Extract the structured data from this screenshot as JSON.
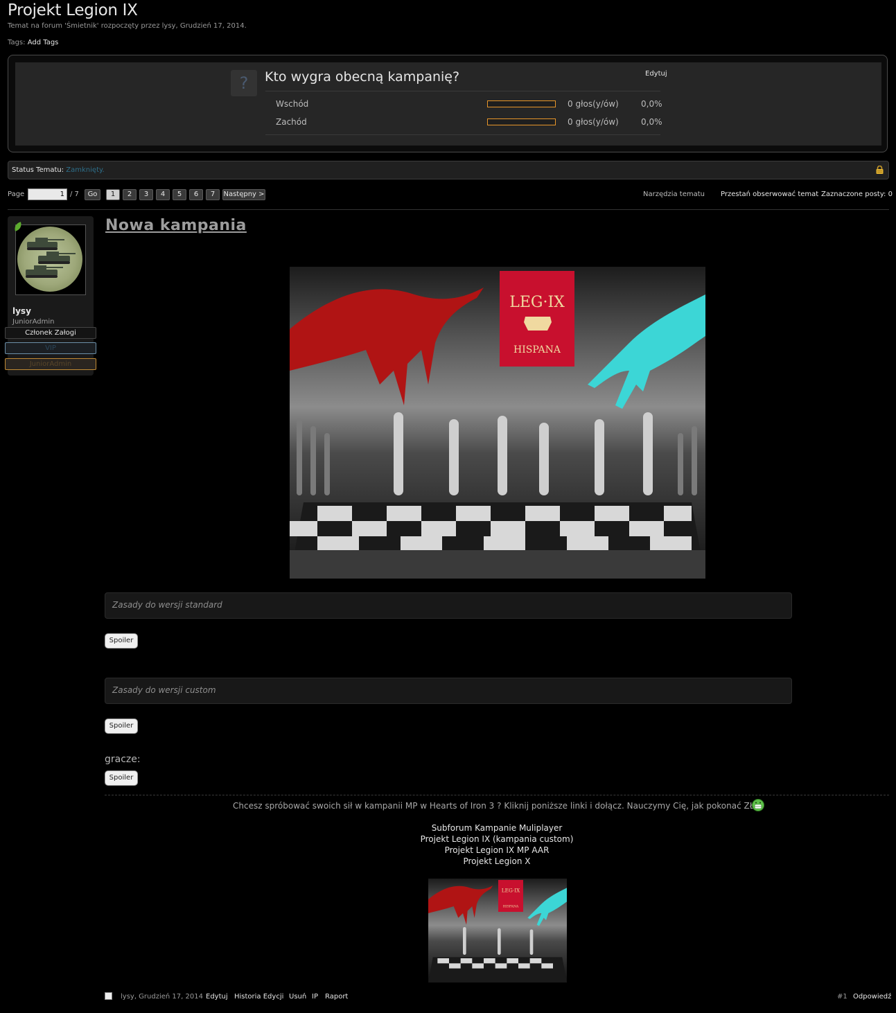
{
  "thread": {
    "title": "Projekt Legion IX",
    "subtitle": "Temat na forum 'Śmietnik' rozpoczęty przez lysy, Grudzień 17, 2014.",
    "tags_label": "Tags:",
    "add_tags": "Add Tags"
  },
  "poll": {
    "icon": "question-icon",
    "question": "Kto wygra obecną kampanię?",
    "edit_label": "Edytuj",
    "options": [
      {
        "label": "Wschód",
        "votes": "0 głos(y/ów)",
        "percent": "0,0%",
        "fill": 0
      },
      {
        "label": "Zachód",
        "votes": "0 głos(y/ów)",
        "percent": "0,0%",
        "fill": 0
      }
    ]
  },
  "status": {
    "label": "Status Tematu:",
    "value": "Zamknięty.",
    "icon": "lock-icon"
  },
  "pagination": {
    "page_label": "Page",
    "current": "1",
    "total": "/ 7",
    "go": "Go",
    "pages": [
      "1",
      "2",
      "3",
      "4",
      "5",
      "6",
      "7"
    ],
    "next": "Następny >",
    "thread_tools": "Narzędzia tematu",
    "unwatch": "Przestań obserwować temat",
    "selected_posts": "Zaznaczone posty: 0"
  },
  "user": {
    "name": "lysy",
    "title": "JuniorAdmin",
    "badges": [
      "Członek Załogi",
      "VIP",
      "JuniorAdmin"
    ]
  },
  "post": {
    "title": "Nowa kampania",
    "hero_logo_line1": "LEG·IX",
    "hero_logo_line2": "HISPANA",
    "quote1": "Zasady do wersji standard",
    "quote2": "Zasady do wersji custom",
    "spoiler": "Spoiler",
    "players": "gracze:"
  },
  "signature": {
    "text": "Chcesz spróbować swoich sił w kampanii MP w Hearts of Iron 3 ? Kliknij poniższe linki i dołącz. Nauczymy Cię, jak pokonać ZŁO",
    "links": [
      "Subforum Kampanie Muliplayer",
      "Projekt Legion IX (kampania custom)",
      "Projekt Legion IX MP AAR",
      "Projekt Legion X"
    ]
  },
  "footer": {
    "meta": "lysy, Grudzień 17, 2014",
    "edit": "Edytuj",
    "history": "Historia Edycji",
    "delete": "Usuń",
    "ip": "IP",
    "report": "Raport",
    "post_number": "#1",
    "reply": "Odpowiedź"
  },
  "colors": {
    "background": "#000000",
    "poll_bar_border": "#e8962a",
    "status_value": "#2e6f8a",
    "vip_border": "#6c8fa8",
    "junior_border": "#c18a34"
  }
}
